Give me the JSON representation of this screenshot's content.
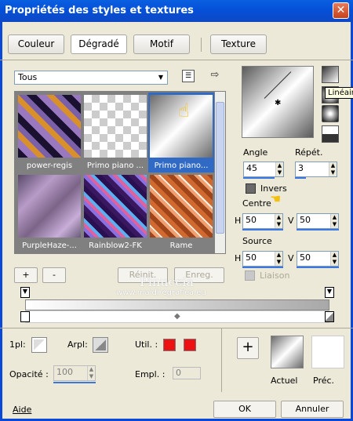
{
  "window": {
    "title": "Propriétés des styles et textures",
    "close": "✕"
  },
  "tabs": [
    "Couleur",
    "Dégradé",
    "Motif",
    "Texture"
  ],
  "gallery": {
    "category": "Tous",
    "items": [
      {
        "label": "power-regis"
      },
      {
        "label": "Primo piano ..."
      },
      {
        "label": "Primo piano..."
      },
      {
        "label": "PurpleHaze-..."
      },
      {
        "label": "Rainblow2-FK"
      },
      {
        "label": "Rame"
      }
    ],
    "add": "+",
    "remove": "-",
    "reset": "Réinit.",
    "save": "Enreg."
  },
  "tooltip": "Linéair",
  "angle": {
    "label": "Angle",
    "value": "45"
  },
  "repeat": {
    "label": "Répét.",
    "value": "3"
  },
  "invert": {
    "label": "Invers"
  },
  "center": {
    "label": "Centre",
    "h_label": "H",
    "h": "50",
    "v_label": "V",
    "v": "50"
  },
  "source": {
    "label": "Source",
    "h_label": "H",
    "h": "50",
    "v_label": "V",
    "v": "50"
  },
  "link": {
    "label": "Liaison"
  },
  "watermark": {
    "line1": "Pinuccia",
    "line2": "www.maidiregrafica.eu"
  },
  "bottom": {
    "pl_label": "1pl:",
    "arpl_label": "Arpl:",
    "util_label": "Util. :",
    "opacity_label": "Opacité :",
    "opacity": "100",
    "empl_label": "Empl. :",
    "empl": "0",
    "current": "Actuel",
    "previous": "Préc.",
    "add": "+"
  },
  "footer": {
    "help": "Aide",
    "ok": "OK",
    "cancel": "Annuler"
  },
  "colors": {
    "util": "#ee1111",
    "title": "#0a5fe0"
  }
}
